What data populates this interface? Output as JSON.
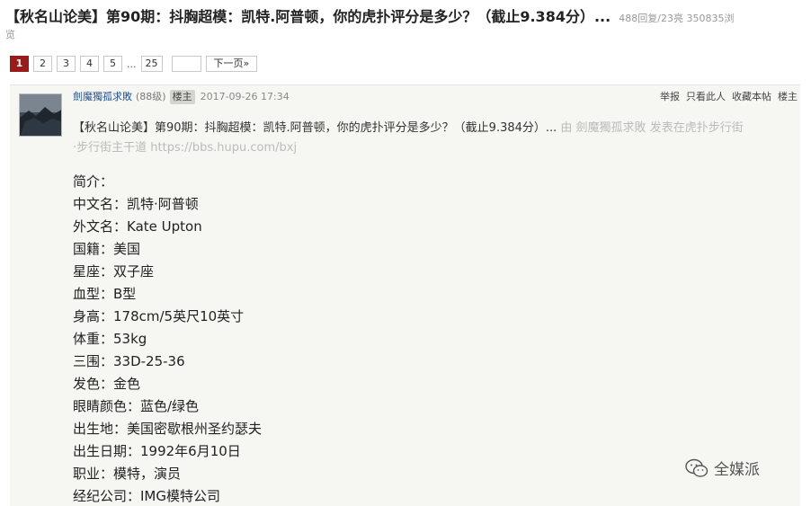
{
  "thread": {
    "title": "【秋名山论美】第90期：抖胸超模：凯特.阿普顿，你的虎扑评分是多少？（截止9.384分）...",
    "stats": "488回复/23亮 350835浏",
    "stats_cont": "览"
  },
  "pager": {
    "pages": [
      "1",
      "2",
      "3",
      "4",
      "5"
    ],
    "ellipsis": "...",
    "last": "25",
    "next": "下一页»"
  },
  "post": {
    "author": "劍魔獨孤求敗",
    "level": "(88级)",
    "op_badge": "楼主",
    "time": "2017-09-26 17:34",
    "actions": [
      "举报",
      "只看此人",
      "收藏本帖",
      "楼主"
    ],
    "quote_main": "【秋名山论美】第90期：抖胸超模：凯特.阿普顿，你的虎扑评分是多少？（截止9.384分）...",
    "quote_dim1": " 由 劍魔獨孤求敗 发表在虎扑步行街",
    "quote_dim2": "·步行街主干道 https://bbs.hupu.com/bxj",
    "lines": [
      "简介：",
      "中文名：凯特·阿普顿",
      "外文名：Kate Upton",
      "国籍：美国",
      "星座：双子座",
      "血型：B型",
      "身高：178cm/5英尺10英寸",
      "体重：53kg",
      "三围：33D-25-36",
      "发色：金色",
      "眼睛颜色：蓝色/绿色",
      "出生地：美国密歇根州圣约瑟夫",
      "出生日期：1992年6月10日",
      "职业：模特，演员",
      "经纪公司：IMG模特公司"
    ]
  },
  "watermark": {
    "text": "全媒派",
    "icon": "wechat-icon"
  },
  "colors": {
    "accent": "#9b1b1b",
    "post_bg": "#f6f7f2",
    "author_link": "#1f4f8f"
  }
}
